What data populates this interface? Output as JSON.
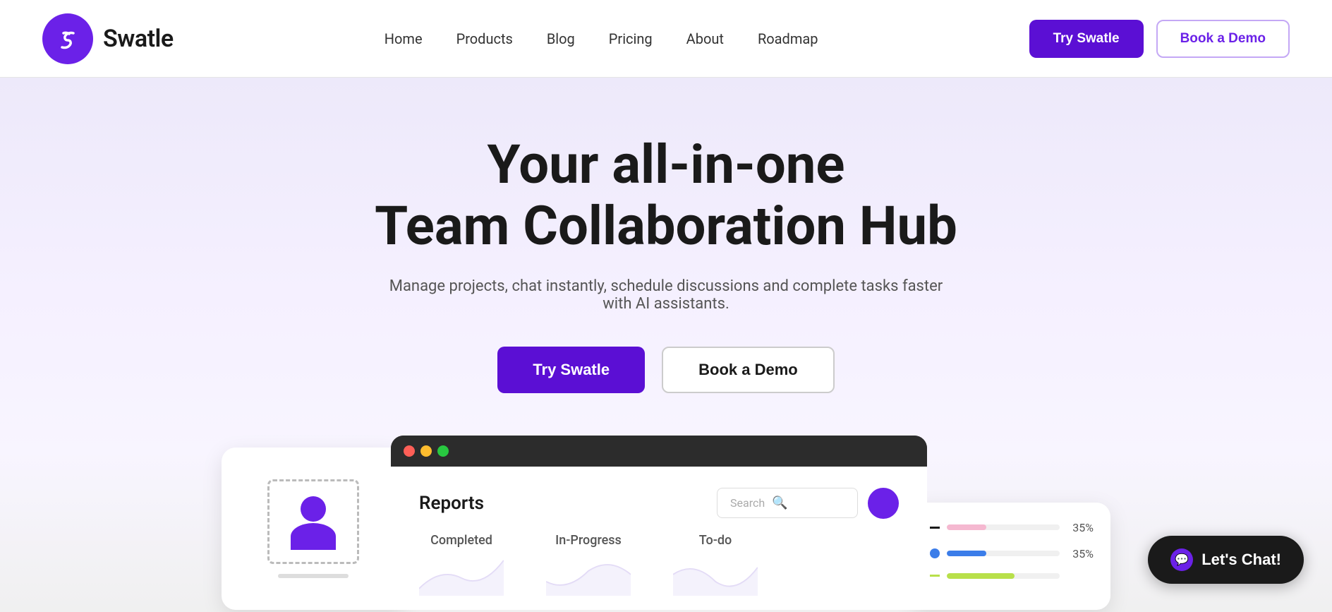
{
  "navbar": {
    "logo_text": "Swatle",
    "nav_items": [
      {
        "label": "Home",
        "id": "home"
      },
      {
        "label": "Products",
        "id": "products"
      },
      {
        "label": "Blog",
        "id": "blog"
      },
      {
        "label": "Pricing",
        "id": "pricing"
      },
      {
        "label": "About",
        "id": "about"
      },
      {
        "label": "Roadmap",
        "id": "roadmap"
      }
    ],
    "btn_try": "Try Swatle",
    "btn_demo": "Book a Demo"
  },
  "hero": {
    "title_line1": "Your all-in-one",
    "title_line2": "Team Collaboration Hub",
    "subtitle": "Manage projects, chat instantly, schedule discussions and complete tasks faster with AI assistants.",
    "btn_try": "Try Swatle",
    "btn_demo": "Book a Demo"
  },
  "app_preview": {
    "title": "Reports",
    "search_placeholder": "Search",
    "stats": [
      {
        "label": "Completed"
      },
      {
        "label": "In-Progress"
      },
      {
        "label": "To-do"
      }
    ]
  },
  "chart_panel": {
    "rows": [
      {
        "color": "pink",
        "percent": "35%",
        "fill_width": "35"
      },
      {
        "color": "blue",
        "percent": "35%",
        "fill_width": "35"
      },
      {
        "color": "green",
        "percent": "",
        "fill_width": "60"
      }
    ]
  },
  "chat_button": {
    "label": "Let's Chat!"
  },
  "colors": {
    "purple": "#5b0fd4",
    "purple_light": "#6b21e8",
    "hero_bg_start": "#ede9fa",
    "hero_bg_end": "#f0f0f0"
  }
}
